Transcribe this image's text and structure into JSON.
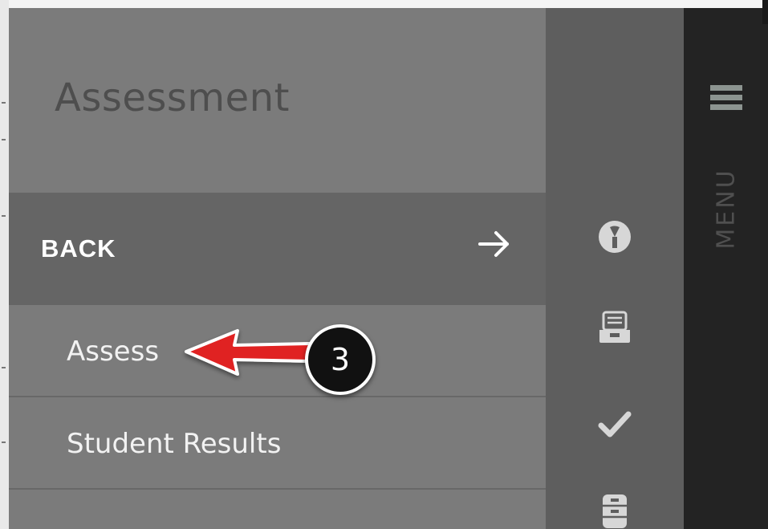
{
  "panel": {
    "title": "Assessment",
    "back_label": "BACK",
    "items": [
      {
        "label": "Assess"
      },
      {
        "label": "Student Results"
      }
    ]
  },
  "menu": {
    "label": "MENU"
  },
  "annotation": {
    "step_number": "3",
    "arrow_color": "#e02020"
  },
  "icons": [
    "dashboard-gauge-icon",
    "inbox-tray-icon",
    "checkmark-icon",
    "cabinet-icon",
    "hamburger-icon",
    "back-arrow-icon"
  ],
  "colors": {
    "panel_bg": "#7b7b7b",
    "back_row_bg": "#656565",
    "rail_bg": "#5e5e5e",
    "menu_bg": "#232323",
    "hamburger": "#8c9490"
  }
}
